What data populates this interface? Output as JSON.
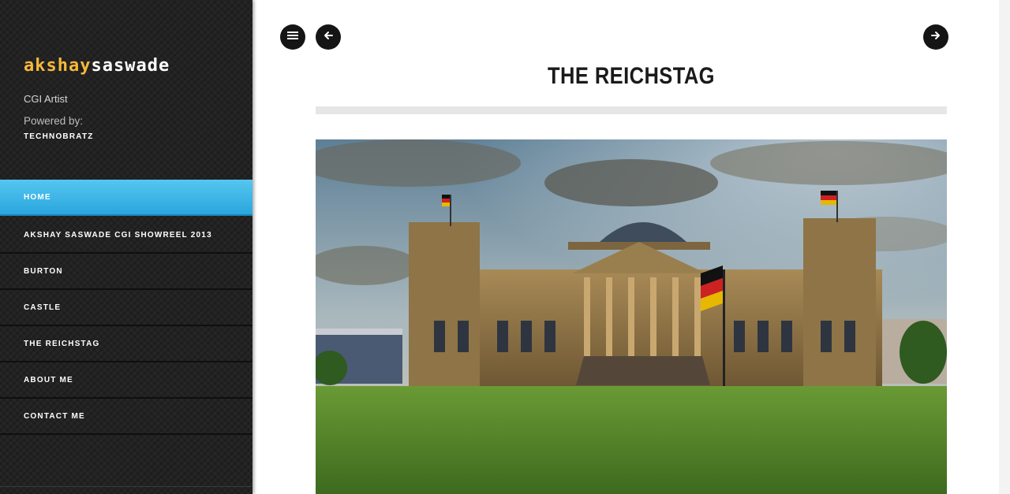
{
  "sidebar": {
    "logo_first": "akshay",
    "logo_second": "saswade",
    "tagline": "CGI Artist",
    "powered_label": "Powered by:",
    "powered_name": "TECHNOBRATZ",
    "nav": [
      {
        "label": "HOME",
        "active": true
      },
      {
        "label": "AKSHAY SASWADE CGI SHOWREEL 2013",
        "active": false
      },
      {
        "label": "BURTON",
        "active": false
      },
      {
        "label": "CASTLE",
        "active": false
      },
      {
        "label": "THE REICHSTAG",
        "active": false
      },
      {
        "label": "ABOUT ME",
        "active": false
      },
      {
        "label": "CONTACT ME",
        "active": false
      }
    ]
  },
  "main": {
    "title": "THE REICHSTAG",
    "icons": {
      "menu": "menu-icon",
      "prev": "arrow-left-icon",
      "next": "arrow-right-icon"
    }
  },
  "colors": {
    "accent": "#2aa6dd",
    "logo_yellow": "#f7b93a",
    "sidebar_bg": "#222222"
  }
}
